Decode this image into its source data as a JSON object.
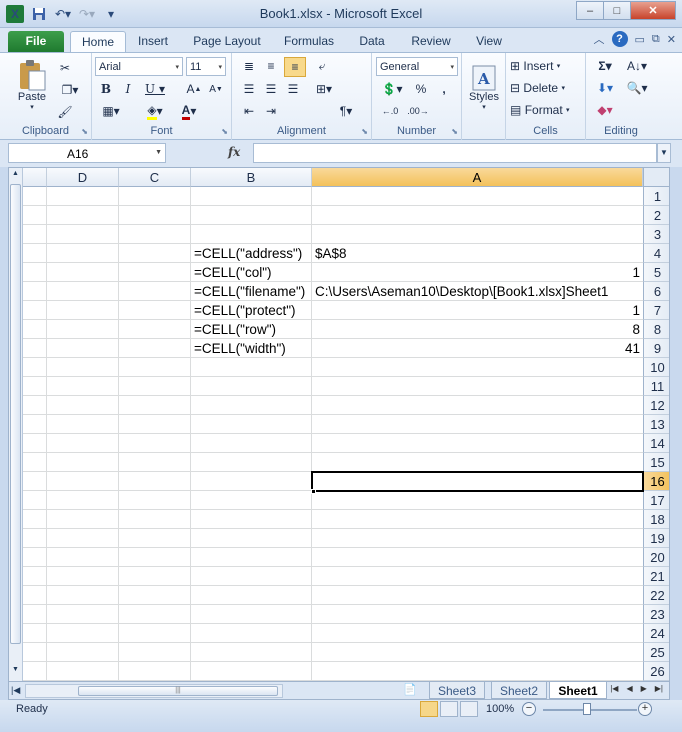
{
  "window": {
    "title": "Book1.xlsx - Microsoft Excel",
    "app_icon": "X",
    "controls": {
      "minimize": "–",
      "maximize": "□",
      "close": "✕"
    }
  },
  "tabs": [
    "File",
    "Home",
    "Insert",
    "Page Layout",
    "Formulas",
    "Data",
    "Review",
    "View"
  ],
  "active_tab": "Home",
  "ribbon": {
    "clipboard": {
      "label": "Clipboard",
      "paste": "Paste"
    },
    "font": {
      "label": "Font",
      "name": "Arial",
      "size": "11"
    },
    "alignment": {
      "label": "Alignment"
    },
    "number": {
      "label": "Number",
      "format": "General"
    },
    "styles": {
      "label": "Styles"
    },
    "cells": {
      "label": "Cells",
      "insert": "Insert",
      "delete": "Delete",
      "format": "Format"
    },
    "editing": {
      "label": "Editing"
    }
  },
  "formula_bar": {
    "name_box": "A16",
    "fx": "fx",
    "value": ""
  },
  "columns": [
    "D",
    "C",
    "B",
    "A"
  ],
  "selected_column": "A",
  "rows": [
    "1",
    "2",
    "3",
    "4",
    "5",
    "6",
    "7",
    "8",
    "9",
    "10",
    "11",
    "12",
    "13",
    "14",
    "15",
    "16",
    "17",
    "18",
    "19",
    "20",
    "21",
    "22",
    "23",
    "24",
    "25",
    "26"
  ],
  "selected_row": "16",
  "cells": {
    "B4": "=CELL(\"address\")",
    "A4": "$A$8",
    "B5": "=CELL(\"col\")",
    "A5": "1",
    "B6": "=CELL(\"filename\")",
    "A6": "C:\\Users\\Aseman10\\Desktop\\[Book1.xlsx]Sheet1",
    "B7": "=CELL(\"protect\")",
    "A7": "1",
    "B8": "=CELL(\"row\")",
    "A8": "8",
    "B9": "=CELL(\"width\")",
    "A9": "41"
  },
  "sheets": [
    "Sheet3",
    "Sheet2",
    "Sheet1"
  ],
  "active_sheet": "Sheet1",
  "status": {
    "ready": "Ready",
    "zoom": "100%"
  }
}
